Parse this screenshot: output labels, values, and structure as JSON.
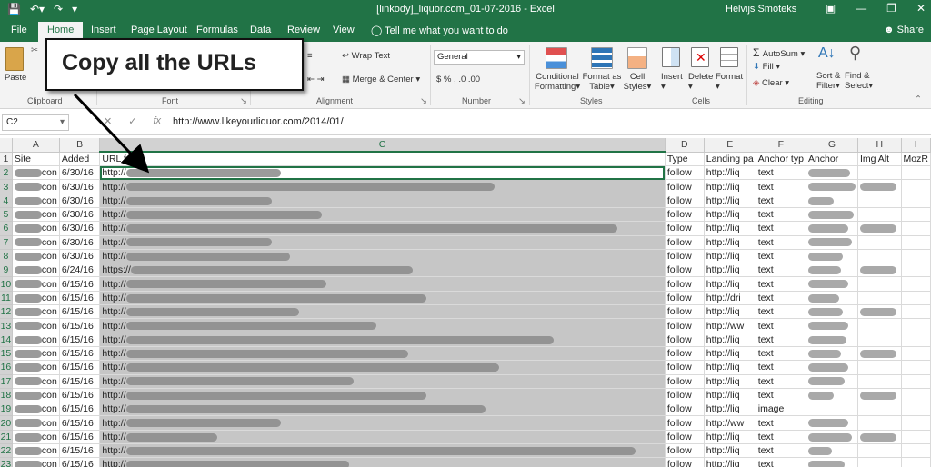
{
  "titlebar": {
    "title": "[linkody]_liquor.com_01-07-2016 - Excel",
    "user": "Helvijs Smoteks",
    "qat": [
      "save-icon",
      "undo-icon",
      "redo-icon"
    ],
    "winctl": [
      "ribbon-display-icon",
      "minimize-icon",
      "restore-icon",
      "close-icon"
    ]
  },
  "tabs": [
    "File",
    "Home",
    "Insert",
    "Page Layout",
    "Formulas",
    "Data",
    "Review",
    "View"
  ],
  "tellme": "Tell me what you want to do",
  "share": "Share",
  "ribbon": {
    "paste": "Paste",
    "clipboard": "Clipboard",
    "font": "Font",
    "wrap_text": "Wrap Text",
    "merge_center": "Merge & Center",
    "alignment": "Alignment",
    "number_format": "General",
    "number_symbols": "% ,",
    "number": "Number",
    "conditional_formatting": "Conditional Formatting",
    "conditional_formatting_l1": "Conditional",
    "conditional_formatting_l2": "Formatting",
    "format_as_table_l1": "Format as",
    "format_as_table_l2": "Table",
    "cell_styles_l1": "Cell",
    "cell_styles_l2": "Styles",
    "styles": "Styles",
    "insert": "Insert",
    "delete": "Delete",
    "format": "Format",
    "cells": "Cells",
    "autosum": "AutoSum",
    "fill": "Fill",
    "clear": "Clear",
    "sort_filter_l1": "Sort &",
    "sort_filter_l2": "Filter",
    "find_select_l1": "Find &",
    "find_select_l2": "Select",
    "editing": "Editing"
  },
  "formula_bar": {
    "name_box": "C2",
    "fx": "fx",
    "value": "http://www.likeyourliquor.com/2014/01/"
  },
  "callout": "Copy all the URLs",
  "grid": {
    "column_letters": [
      "A",
      "B",
      "C",
      "D",
      "E",
      "F",
      "G",
      "H",
      "I"
    ],
    "headers": [
      "Site",
      "Added",
      "URL from",
      "Type",
      "Landing pa",
      "Anchor typ",
      "Anchor",
      "Img Alt",
      "MozR"
    ],
    "rows": [
      {
        "n": "2",
        "site": "con",
        "added": "6/30/16",
        "url": "http://",
        "type": "follow",
        "landing": "http://liq",
        "atype": "text"
      },
      {
        "n": "3",
        "site": "con",
        "added": "6/30/16",
        "url": "http://",
        "type": "follow",
        "landing": "http://liq",
        "atype": "text"
      },
      {
        "n": "4",
        "site": "con",
        "added": "6/30/16",
        "url": "http://",
        "type": "follow",
        "landing": "http://liq",
        "atype": "text"
      },
      {
        "n": "5",
        "site": "con",
        "added": "6/30/16",
        "url": "http://",
        "type": "follow",
        "landing": "http://liq",
        "atype": "text"
      },
      {
        "n": "6",
        "site": "con",
        "added": "6/30/16",
        "url": "http://",
        "type": "follow",
        "landing": "http://liq",
        "atype": "text"
      },
      {
        "n": "7",
        "site": "con",
        "added": "6/30/16",
        "url": "http://",
        "type": "follow",
        "landing": "http://liq",
        "atype": "text"
      },
      {
        "n": "8",
        "site": "con",
        "added": "6/30/16",
        "url": "http://",
        "type": "follow",
        "landing": "http://liq",
        "atype": "text"
      },
      {
        "n": "9",
        "site": "con",
        "added": "6/24/16",
        "url": "https://",
        "type": "follow",
        "landing": "http://liq",
        "atype": "text"
      },
      {
        "n": "10",
        "site": "con",
        "added": "6/15/16",
        "url": "http://",
        "type": "follow",
        "landing": "http://liq",
        "atype": "text"
      },
      {
        "n": "11",
        "site": "con",
        "added": "6/15/16",
        "url": "http://",
        "type": "follow",
        "landing": "http://dri",
        "atype": "text"
      },
      {
        "n": "12",
        "site": "con",
        "added": "6/15/16",
        "url": "http://",
        "type": "follow",
        "landing": "http://liq",
        "atype": "text"
      },
      {
        "n": "13",
        "site": "con",
        "added": "6/15/16",
        "url": "http://",
        "type": "follow",
        "landing": "http://ww",
        "atype": "text"
      },
      {
        "n": "14",
        "site": "con",
        "added": "6/15/16",
        "url": "http://",
        "type": "follow",
        "landing": "http://liq",
        "atype": "text"
      },
      {
        "n": "15",
        "site": "con",
        "added": "6/15/16",
        "url": "http://",
        "type": "follow",
        "landing": "http://liq",
        "atype": "text"
      },
      {
        "n": "16",
        "site": "con",
        "added": "6/15/16",
        "url": "http://",
        "type": "follow",
        "landing": "http://liq",
        "atype": "text"
      },
      {
        "n": "17",
        "site": "con",
        "added": "6/15/16",
        "url": "http://",
        "type": "follow",
        "landing": "http://liq",
        "atype": "text"
      },
      {
        "n": "18",
        "site": "con",
        "added": "6/15/16",
        "url": "http://",
        "type": "follow",
        "landing": "http://liq",
        "atype": "text"
      },
      {
        "n": "19",
        "site": "con",
        "added": "6/15/16",
        "url": "http://",
        "type": "follow",
        "landing": "http://liq",
        "atype": "image"
      },
      {
        "n": "20",
        "site": "con",
        "added": "6/15/16",
        "url": "http://",
        "type": "follow",
        "landing": "http://ww",
        "atype": "text"
      },
      {
        "n": "21",
        "site": "con",
        "added": "6/15/16",
        "url": "http://",
        "type": "follow",
        "landing": "http://liq",
        "atype": "text"
      },
      {
        "n": "22",
        "site": "con",
        "added": "6/15/16",
        "url": "http://",
        "type": "follow",
        "landing": "http://liq",
        "atype": "text"
      },
      {
        "n": "23",
        "site": "con",
        "added": "6/15/16",
        "url": "http://",
        "type": "follow",
        "landing": "http://liq",
        "atype": "text"
      }
    ]
  },
  "colors": {
    "excel_green": "#217346",
    "selection": "#c6c6c6"
  }
}
